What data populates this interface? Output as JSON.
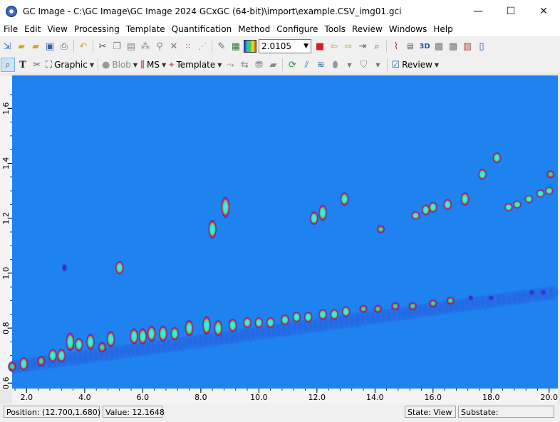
{
  "window": {
    "title": "GC Image - C:\\GC Image\\GC Image 2024 GCxGC (64-bit)\\import\\example.CSV_img01.gci",
    "minimize": "—",
    "maximize": "☐",
    "close": "✕"
  },
  "menu": [
    "File",
    "Edit",
    "View",
    "Processing",
    "Template",
    "Quantification",
    "Method",
    "Configure",
    "Tools",
    "Review",
    "Windows",
    "Help"
  ],
  "toolbar1": {
    "zoom_value": "2.0105"
  },
  "toolbar2": {
    "graphic_label": "Graphic",
    "blob_label": "Blob",
    "ms_label": "MS",
    "template_label": "Template",
    "review_label": "Review"
  },
  "plot": {
    "background": "#1e82ef",
    "y_ticks": [
      "0.6",
      "0.8",
      "1.0",
      "1.2",
      "1.4",
      "1.6"
    ],
    "x_ticks": [
      "2.0",
      "4.0",
      "6.0",
      "8.0",
      "10.0",
      "12.0",
      "14.0",
      "16.0",
      "18.0",
      "20.0"
    ]
  },
  "chart_data": {
    "type": "heatmap",
    "x_range": [
      1.5,
      20.3
    ],
    "y_range": [
      0.58,
      1.72
    ],
    "y_ticks": [
      0.6,
      0.8,
      1.0,
      1.2,
      1.4,
      1.6
    ],
    "x_ticks": [
      2.0,
      4.0,
      6.0,
      8.0,
      10.0,
      12.0,
      14.0,
      16.0,
      18.0,
      20.0
    ],
    "blobs": [
      {
        "x": 1.9,
        "y": 0.67,
        "h": 0.05,
        "level": 3
      },
      {
        "x": 2.5,
        "y": 0.68,
        "h": 0.04,
        "level": 2
      },
      {
        "x": 2.9,
        "y": 0.7,
        "h": 0.05,
        "level": 3
      },
      {
        "x": 3.2,
        "y": 0.7,
        "h": 0.05,
        "level": 3
      },
      {
        "x": 3.5,
        "y": 0.75,
        "h": 0.07,
        "level": 3
      },
      {
        "x": 3.8,
        "y": 0.74,
        "h": 0.05,
        "level": 3
      },
      {
        "x": 4.2,
        "y": 0.75,
        "h": 0.06,
        "level": 3
      },
      {
        "x": 4.6,
        "y": 0.73,
        "h": 0.04,
        "level": 2
      },
      {
        "x": 4.9,
        "y": 0.76,
        "h": 0.06,
        "level": 3
      },
      {
        "x": 5.7,
        "y": 0.77,
        "h": 0.06,
        "level": 3
      },
      {
        "x": 6.0,
        "y": 0.77,
        "h": 0.06,
        "level": 3
      },
      {
        "x": 6.3,
        "y": 0.78,
        "h": 0.06,
        "level": 3
      },
      {
        "x": 6.7,
        "y": 0.78,
        "h": 0.06,
        "level": 3
      },
      {
        "x": 7.1,
        "y": 0.78,
        "h": 0.05,
        "level": 3
      },
      {
        "x": 7.6,
        "y": 0.8,
        "h": 0.06,
        "level": 3
      },
      {
        "x": 8.2,
        "y": 0.81,
        "h": 0.07,
        "level": 3
      },
      {
        "x": 8.6,
        "y": 0.8,
        "h": 0.06,
        "level": 3
      },
      {
        "x": 9.1,
        "y": 0.81,
        "h": 0.05,
        "level": 3
      },
      {
        "x": 9.6,
        "y": 0.82,
        "h": 0.04,
        "level": 3
      },
      {
        "x": 10.0,
        "y": 0.82,
        "h": 0.04,
        "level": 3
      },
      {
        "x": 10.4,
        "y": 0.82,
        "h": 0.04,
        "level": 3
      },
      {
        "x": 10.9,
        "y": 0.83,
        "h": 0.04,
        "level": 3
      },
      {
        "x": 11.3,
        "y": 0.84,
        "h": 0.04,
        "level": 3
      },
      {
        "x": 11.7,
        "y": 0.84,
        "h": 0.04,
        "level": 3
      },
      {
        "x": 12.2,
        "y": 0.85,
        "h": 0.04,
        "level": 3
      },
      {
        "x": 12.6,
        "y": 0.85,
        "h": 0.04,
        "level": 3
      },
      {
        "x": 13.0,
        "y": 0.86,
        "h": 0.04,
        "level": 3
      },
      {
        "x": 13.6,
        "y": 0.87,
        "h": 0.03,
        "level": 2
      },
      {
        "x": 14.1,
        "y": 0.87,
        "h": 0.03,
        "level": 2
      },
      {
        "x": 14.7,
        "y": 0.88,
        "h": 0.03,
        "level": 2
      },
      {
        "x": 15.3,
        "y": 0.88,
        "h": 0.03,
        "level": 2
      },
      {
        "x": 16.0,
        "y": 0.89,
        "h": 0.03,
        "level": 2
      },
      {
        "x": 16.6,
        "y": 0.9,
        "h": 0.03,
        "level": 2
      },
      {
        "x": 17.3,
        "y": 0.91,
        "h": 0.02,
        "level": 1
      },
      {
        "x": 18.0,
        "y": 0.91,
        "h": 0.02,
        "level": 1
      },
      {
        "x": 19.4,
        "y": 0.93,
        "h": 0.02,
        "level": 1
      },
      {
        "x": 19.8,
        "y": 0.93,
        "h": 0.02,
        "level": 1
      },
      {
        "x": 1.5,
        "y": 0.66,
        "h": 0.04,
        "level": 2
      },
      {
        "x": 8.4,
        "y": 1.16,
        "h": 0.07,
        "level": 3
      },
      {
        "x": 8.85,
        "y": 1.24,
        "h": 0.08,
        "level": 3
      },
      {
        "x": 5.2,
        "y": 1.02,
        "h": 0.05,
        "level": 3
      },
      {
        "x": 3.3,
        "y": 1.02,
        "h": 0.03,
        "level": 1
      },
      {
        "x": 11.9,
        "y": 1.2,
        "h": 0.05,
        "level": 3
      },
      {
        "x": 12.2,
        "y": 1.22,
        "h": 0.06,
        "level": 3
      },
      {
        "x": 12.95,
        "y": 1.27,
        "h": 0.05,
        "level": 3
      },
      {
        "x": 14.2,
        "y": 1.16,
        "h": 0.03,
        "level": 2
      },
      {
        "x": 15.4,
        "y": 1.21,
        "h": 0.03,
        "level": 3
      },
      {
        "x": 15.75,
        "y": 1.23,
        "h": 0.04,
        "level": 3
      },
      {
        "x": 16.0,
        "y": 1.24,
        "h": 0.04,
        "level": 3
      },
      {
        "x": 16.5,
        "y": 1.25,
        "h": 0.04,
        "level": 3
      },
      {
        "x": 17.1,
        "y": 1.27,
        "h": 0.05,
        "level": 3
      },
      {
        "x": 17.7,
        "y": 1.36,
        "h": 0.04,
        "level": 3
      },
      {
        "x": 18.2,
        "y": 1.42,
        "h": 0.04,
        "level": 3
      },
      {
        "x": 18.6,
        "y": 1.24,
        "h": 0.03,
        "level": 3
      },
      {
        "x": 18.9,
        "y": 1.25,
        "h": 0.03,
        "level": 3
      },
      {
        "x": 19.3,
        "y": 1.27,
        "h": 0.03,
        "level": 3
      },
      {
        "x": 19.7,
        "y": 1.29,
        "h": 0.03,
        "level": 3
      },
      {
        "x": 20.0,
        "y": 1.3,
        "h": 0.03,
        "level": 3
      },
      {
        "x": 20.05,
        "y": 1.36,
        "h": 0.03,
        "level": 2
      }
    ]
  },
  "status": {
    "position": "Position: (12.700,1.680)",
    "value": "Value: 12.1648",
    "state": "State: View",
    "substate": "Substate:"
  }
}
